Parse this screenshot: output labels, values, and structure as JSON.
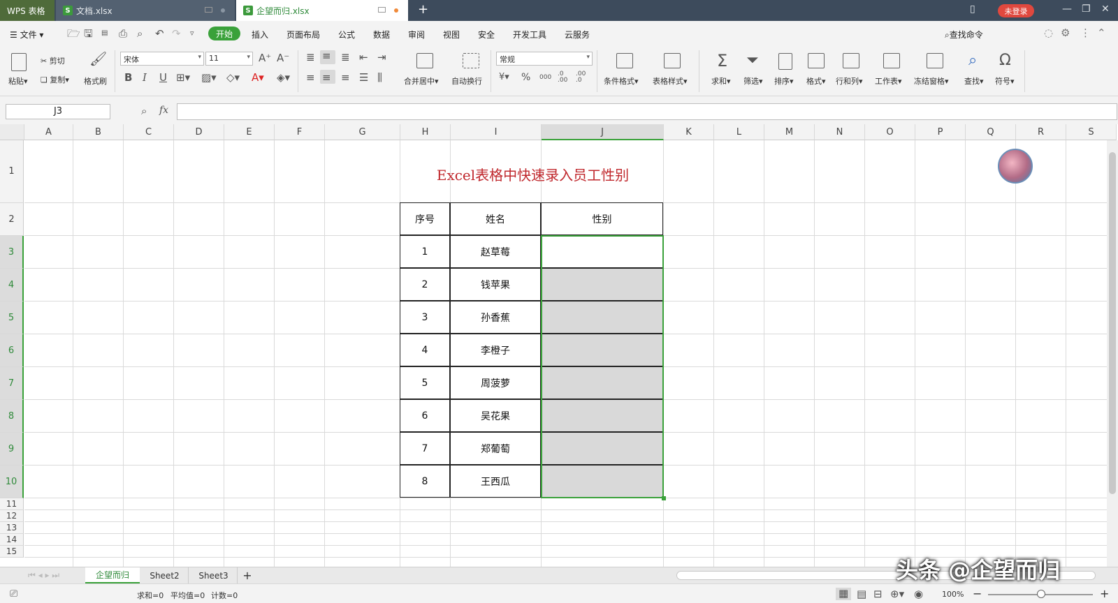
{
  "titlebar": {
    "app_tab": "WPS 表格",
    "tabs": [
      {
        "label": "文档.xlsx",
        "active": false
      },
      {
        "label": "企望而归.xlsx",
        "active": true
      }
    ],
    "new_tab": "+",
    "login": "未登录",
    "colors": {
      "bar": "#3d4b5c",
      "accent": "#3aa13a",
      "login": "#e0483e"
    }
  },
  "menu": {
    "file": "文件",
    "items": [
      "开始",
      "插入",
      "页面布局",
      "公式",
      "数据",
      "审阅",
      "视图",
      "安全",
      "开发工具",
      "云服务"
    ],
    "search": "查找命令"
  },
  "ribbon": {
    "paste": "粘贴",
    "cut": "剪切",
    "copy": "复制",
    "format_painter": "格式刷",
    "font_name": "宋体",
    "font_size": "11",
    "number_format": "常规",
    "merge": "合并居中",
    "wrap": "自动换行",
    "cond_format": "条件格式",
    "table_style": "表格样式",
    "sum": "求和",
    "filter": "筛选",
    "sort": "排序",
    "format": "格式",
    "row_col": "行和列",
    "worksheet": "工作表",
    "freeze": "冻结窗格",
    "find": "查找",
    "symbol": "符号",
    "bold": "B",
    "italic": "I",
    "underline": "U",
    "percent": "%",
    "thousands": "000",
    "inc_dec": ".0 .00",
    "dec_dec": ".00 .0"
  },
  "formula_bar": {
    "name_box": "J3",
    "fx": "fx",
    "value": ""
  },
  "columns": [
    "A",
    "B",
    "C",
    "D",
    "E",
    "F",
    "G",
    "H",
    "I",
    "J",
    "K",
    "L",
    "M",
    "N",
    "O",
    "P",
    "Q",
    "R",
    "S"
  ],
  "rows": [
    "1",
    "2",
    "3",
    "4",
    "5",
    "6",
    "7",
    "8",
    "9",
    "10",
    "11",
    "12",
    "13",
    "14",
    "15"
  ],
  "sheet": {
    "title": "Excel表格中快速录入员工性别",
    "headers": [
      "序号",
      "姓名",
      "性别"
    ],
    "records": [
      {
        "no": "1",
        "name": "赵草莓",
        "gender": ""
      },
      {
        "no": "2",
        "name": "钱苹果",
        "gender": ""
      },
      {
        "no": "3",
        "name": "孙香蕉",
        "gender": ""
      },
      {
        "no": "4",
        "name": "李橙子",
        "gender": ""
      },
      {
        "no": "5",
        "name": "周菠萝",
        "gender": ""
      },
      {
        "no": "6",
        "name": "吴花果",
        "gender": ""
      },
      {
        "no": "7",
        "name": "郑葡萄",
        "gender": ""
      },
      {
        "no": "8",
        "name": "王西瓜",
        "gender": ""
      }
    ],
    "title_color": "#c0282d",
    "selection_color": "#3aa13a",
    "selection_fill": "#d9d9d9"
  },
  "sheet_tabs": [
    "企望而归",
    "Sheet2",
    "Sheet3"
  ],
  "add_sheet": "+",
  "status": {
    "sum": "求和=0",
    "avg": "平均值=0",
    "count": "计数=0",
    "zoom": "100%",
    "minus": "−",
    "plus": "+"
  },
  "watermark": "头条 @企望而归"
}
